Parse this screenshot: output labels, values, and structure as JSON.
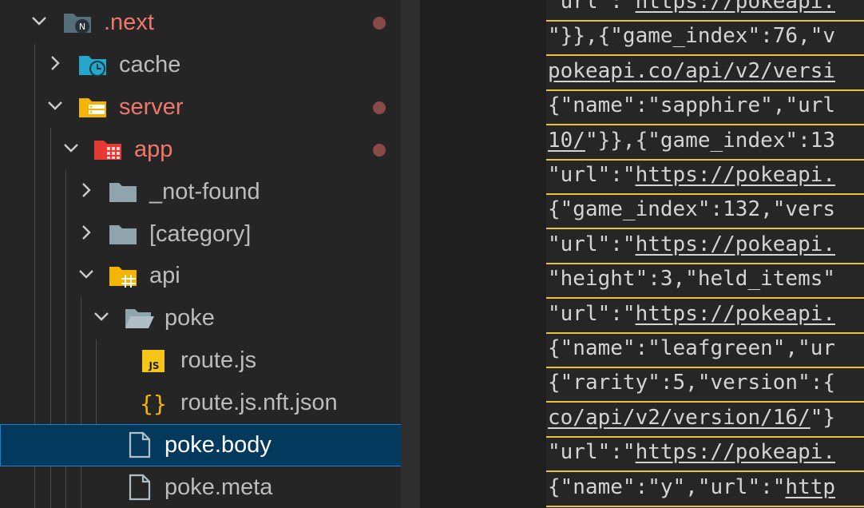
{
  "explorer": {
    "items": [
      {
        "label": ".next",
        "icon": "nextjs-folder-icon",
        "expanded": true,
        "modified": true
      },
      {
        "label": "cache",
        "icon": "cache-folder-icon",
        "expanded": false,
        "modified": false
      },
      {
        "label": "server",
        "icon": "server-folder-icon",
        "expanded": true,
        "modified": true
      },
      {
        "label": "app",
        "icon": "app-folder-icon",
        "expanded": true,
        "modified": true
      },
      {
        "label": "_not-found",
        "icon": "folder-icon",
        "expanded": false,
        "modified": false
      },
      {
        "label": "[category]",
        "icon": "folder-icon",
        "expanded": false,
        "modified": false
      },
      {
        "label": "api",
        "icon": "api-folder-icon",
        "expanded": true,
        "modified": false
      },
      {
        "label": "poke",
        "icon": "open-folder-icon",
        "expanded": true,
        "modified": false
      },
      {
        "label": "route.js",
        "icon": "javascript-file-icon",
        "badge": "JS"
      },
      {
        "label": "route.js.nft.json",
        "icon": "json-file-icon",
        "badge": "{}"
      },
      {
        "label": "poke.body",
        "icon": "file-icon",
        "selected": true
      },
      {
        "label": "poke.meta",
        "icon": "file-icon"
      }
    ]
  },
  "editor": {
    "lines": [
      [
        {
          "t": "\"url\":\""
        },
        {
          "t": "https://pokeapi.",
          "u": true
        }
      ],
      [
        {
          "t": "\"}},{\"game_index\":76,\"v"
        }
      ],
      [
        {
          "t": "pokeapi.co/api/v2/versi",
          "u": true
        }
      ],
      [
        {
          "t": "{\"name\":\"sapphire\",\"url"
        }
      ],
      [
        {
          "t": "10/",
          "u": true
        },
        {
          "t": "\"}},{\"game_index\":13"
        }
      ],
      [
        {
          "t": "\"url\":\""
        },
        {
          "t": "https://pokeapi.",
          "u": true
        }
      ],
      [
        {
          "t": "{\"game_index\":132,\"vers"
        }
      ],
      [
        {
          "t": "\"url\":\""
        },
        {
          "t": "https://pokeapi.",
          "u": true
        }
      ],
      [
        {
          "t": "\"height\":3,\"held_items\""
        }
      ],
      [
        {
          "t": "\"url\":\""
        },
        {
          "t": "https://pokeapi.",
          "u": true
        }
      ],
      [
        {
          "t": "{\"name\":\"leafgreen\",\"ur"
        }
      ],
      [
        {
          "t": "{\"rarity\":5,\"version\":{"
        }
      ],
      [
        {
          "t": "co/api/v2/version/16/",
          "u": true
        },
        {
          "t": "\"}"
        }
      ],
      [
        {
          "t": "\"url\":\""
        },
        {
          "t": "https://pokeapi.",
          "u": true
        }
      ],
      [
        {
          "t": "{\"name\":\"y\",\"url\":\""
        },
        {
          "t": "http",
          "u": true
        }
      ]
    ]
  },
  "colors": {
    "git_modified_text": "#f0776a",
    "selection_bg": "#04395e",
    "search_highlight": "#e8c33a"
  }
}
